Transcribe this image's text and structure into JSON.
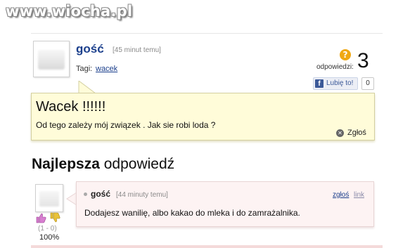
{
  "watermark": "www.wiocha.pl",
  "question": {
    "author": "gość",
    "time": "[45 minut temu]",
    "tags_label": "Tagi:",
    "tag": "wacek",
    "answers_label": "odpowiedzi:",
    "answers_count": "3",
    "answers_icon": "question-mark-icon",
    "like_button": "Lubię to!",
    "like_count": "0",
    "title": "Wacek !!!!!!",
    "text": "Od tego zależy mój związek . Jak sie robi loda ?",
    "report": "Zgłoś"
  },
  "best_answer": {
    "heading_bold": "Najlepsza",
    "heading_rest": "odpowiedź",
    "author": "gość",
    "time": "[44 minuty temu]",
    "report_link": "zgłoś",
    "link": "link",
    "text": "Dodajesz wanilię, albo kakao do mleka i do zamrażalnika.",
    "votes": "(1 - 0)",
    "percent": "100%"
  },
  "colors": {
    "author_blue": "#1b3f8c",
    "question_bg": "#fffcd9",
    "answer_bg": "#fdf3f3",
    "answers_badge": "#f0a813"
  }
}
